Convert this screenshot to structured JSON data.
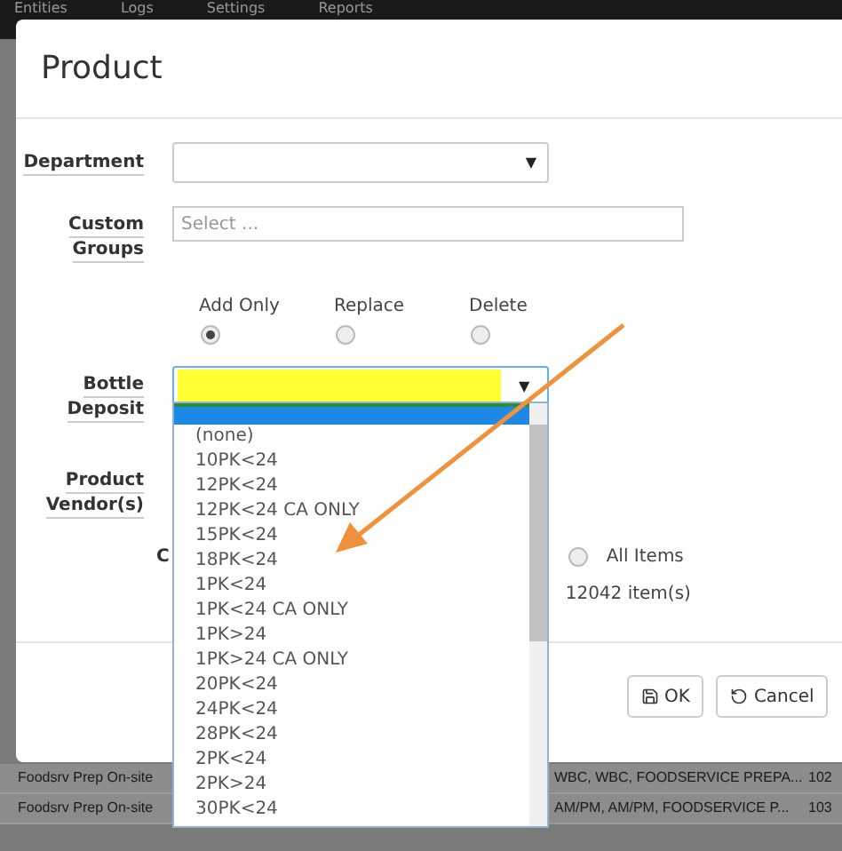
{
  "nav": [
    {
      "label": "Entities"
    },
    {
      "label": "Logs"
    },
    {
      "label": "Settings"
    },
    {
      "label": "Reports"
    }
  ],
  "background_rows": [
    {
      "cells": [
        "Foodsrv Prep On-site",
        "WBC, WBC, FOODSERVICE PREPA...",
        "102"
      ]
    },
    {
      "cells": [
        "Foodsrv Prep On-site",
        "AM/PM, AM/PM, FOODSERVICE P...",
        "103"
      ]
    }
  ],
  "dialog": {
    "title": "Product",
    "department": {
      "label": "Department",
      "caret": "▼"
    },
    "custom_groups": {
      "label_lines": [
        "Custom",
        "Groups"
      ],
      "placeholder": "Select ..."
    },
    "mode_options": [
      {
        "label": "Add Only",
        "selected": true
      },
      {
        "label": "Replace",
        "selected": false
      },
      {
        "label": "Delete",
        "selected": false
      }
    ],
    "bottle_deposit": {
      "label_lines": [
        "Bottle",
        "Deposit"
      ],
      "highlighted": true,
      "expanded": true,
      "caret": "▼",
      "options": [
        {
          "label": "(none)"
        },
        {
          "label": "10PK<24"
        },
        {
          "label": "12PK<24"
        },
        {
          "label": "12PK<24 CA ONLY"
        },
        {
          "label": "15PK<24"
        },
        {
          "label": "18PK<24"
        },
        {
          "label": "1PK<24"
        },
        {
          "label": "1PK<24 CA ONLY"
        },
        {
          "label": "1PK>24"
        },
        {
          "label": "1PK>24 CA ONLY"
        },
        {
          "label": "20PK<24"
        },
        {
          "label": "24PK<24"
        },
        {
          "label": "28PK<24"
        },
        {
          "label": "2PK<24"
        },
        {
          "label": "2PK>24"
        },
        {
          "label": "30PK<24"
        }
      ]
    },
    "product_vendors": {
      "label_lines": [
        "Product",
        "Vendor(s)"
      ]
    },
    "partial_label": "C",
    "all_items": {
      "label": "All Items",
      "selected": false
    },
    "item_count": "12042 item(s)",
    "buttons": [
      {
        "kind": "ok",
        "label": "OK"
      },
      {
        "kind": "cancel",
        "label": "Cancel"
      }
    ]
  }
}
